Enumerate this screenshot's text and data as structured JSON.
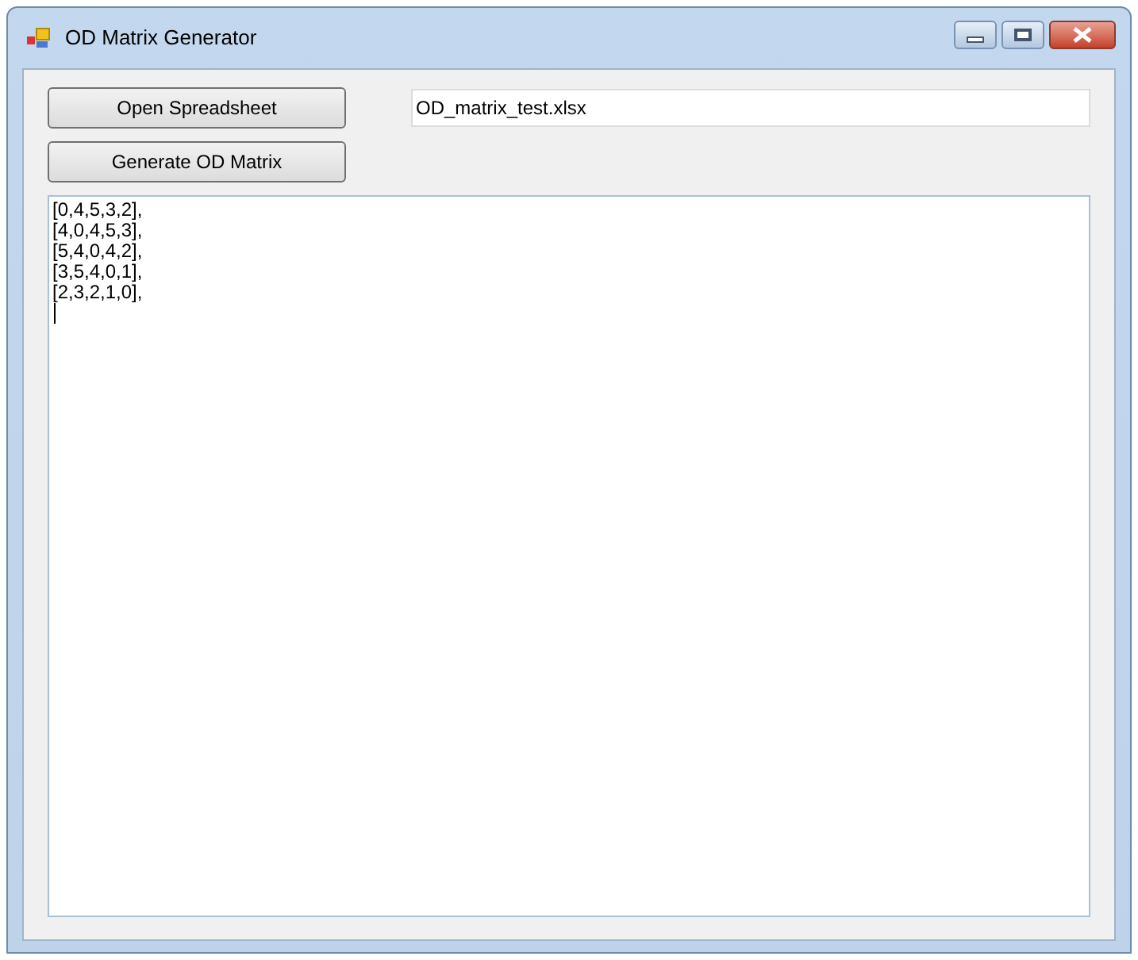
{
  "window": {
    "title": "OD Matrix Generator"
  },
  "buttons": [
    "Open Spreadsheet",
    "Generate OD Matrix"
  ],
  "file_field": {
    "value": "OD_matrix_test.xlsx"
  },
  "output": {
    "lines": [
      "[0,4,5,3,2],",
      "[4,0,4,5,3],",
      "[5,4,0,4,2],",
      "[3,5,4,0,1],",
      "[2,3,2,1,0],"
    ],
    "caret": true
  }
}
